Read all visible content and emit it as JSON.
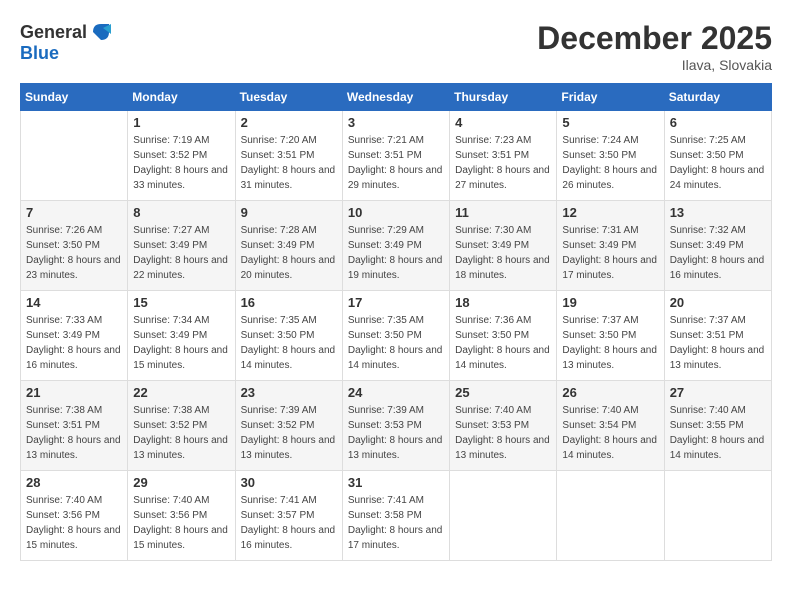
{
  "header": {
    "logo_general": "General",
    "logo_blue": "Blue",
    "month_title": "December 2025",
    "location": "Ilava, Slovakia"
  },
  "days_of_week": [
    "Sunday",
    "Monday",
    "Tuesday",
    "Wednesday",
    "Thursday",
    "Friday",
    "Saturday"
  ],
  "weeks": [
    [
      {
        "day": "",
        "sunrise": "",
        "sunset": "",
        "daylight": ""
      },
      {
        "day": "1",
        "sunrise": "Sunrise: 7:19 AM",
        "sunset": "Sunset: 3:52 PM",
        "daylight": "Daylight: 8 hours and 33 minutes."
      },
      {
        "day": "2",
        "sunrise": "Sunrise: 7:20 AM",
        "sunset": "Sunset: 3:51 PM",
        "daylight": "Daylight: 8 hours and 31 minutes."
      },
      {
        "day": "3",
        "sunrise": "Sunrise: 7:21 AM",
        "sunset": "Sunset: 3:51 PM",
        "daylight": "Daylight: 8 hours and 29 minutes."
      },
      {
        "day": "4",
        "sunrise": "Sunrise: 7:23 AM",
        "sunset": "Sunset: 3:51 PM",
        "daylight": "Daylight: 8 hours and 27 minutes."
      },
      {
        "day": "5",
        "sunrise": "Sunrise: 7:24 AM",
        "sunset": "Sunset: 3:50 PM",
        "daylight": "Daylight: 8 hours and 26 minutes."
      },
      {
        "day": "6",
        "sunrise": "Sunrise: 7:25 AM",
        "sunset": "Sunset: 3:50 PM",
        "daylight": "Daylight: 8 hours and 24 minutes."
      }
    ],
    [
      {
        "day": "7",
        "sunrise": "Sunrise: 7:26 AM",
        "sunset": "Sunset: 3:50 PM",
        "daylight": "Daylight: 8 hours and 23 minutes."
      },
      {
        "day": "8",
        "sunrise": "Sunrise: 7:27 AM",
        "sunset": "Sunset: 3:49 PM",
        "daylight": "Daylight: 8 hours and 22 minutes."
      },
      {
        "day": "9",
        "sunrise": "Sunrise: 7:28 AM",
        "sunset": "Sunset: 3:49 PM",
        "daylight": "Daylight: 8 hours and 20 minutes."
      },
      {
        "day": "10",
        "sunrise": "Sunrise: 7:29 AM",
        "sunset": "Sunset: 3:49 PM",
        "daylight": "Daylight: 8 hours and 19 minutes."
      },
      {
        "day": "11",
        "sunrise": "Sunrise: 7:30 AM",
        "sunset": "Sunset: 3:49 PM",
        "daylight": "Daylight: 8 hours and 18 minutes."
      },
      {
        "day": "12",
        "sunrise": "Sunrise: 7:31 AM",
        "sunset": "Sunset: 3:49 PM",
        "daylight": "Daylight: 8 hours and 17 minutes."
      },
      {
        "day": "13",
        "sunrise": "Sunrise: 7:32 AM",
        "sunset": "Sunset: 3:49 PM",
        "daylight": "Daylight: 8 hours and 16 minutes."
      }
    ],
    [
      {
        "day": "14",
        "sunrise": "Sunrise: 7:33 AM",
        "sunset": "Sunset: 3:49 PM",
        "daylight": "Daylight: 8 hours and 16 minutes."
      },
      {
        "day": "15",
        "sunrise": "Sunrise: 7:34 AM",
        "sunset": "Sunset: 3:49 PM",
        "daylight": "Daylight: 8 hours and 15 minutes."
      },
      {
        "day": "16",
        "sunrise": "Sunrise: 7:35 AM",
        "sunset": "Sunset: 3:50 PM",
        "daylight": "Daylight: 8 hours and 14 minutes."
      },
      {
        "day": "17",
        "sunrise": "Sunrise: 7:35 AM",
        "sunset": "Sunset: 3:50 PM",
        "daylight": "Daylight: 8 hours and 14 minutes."
      },
      {
        "day": "18",
        "sunrise": "Sunrise: 7:36 AM",
        "sunset": "Sunset: 3:50 PM",
        "daylight": "Daylight: 8 hours and 14 minutes."
      },
      {
        "day": "19",
        "sunrise": "Sunrise: 7:37 AM",
        "sunset": "Sunset: 3:50 PM",
        "daylight": "Daylight: 8 hours and 13 minutes."
      },
      {
        "day": "20",
        "sunrise": "Sunrise: 7:37 AM",
        "sunset": "Sunset: 3:51 PM",
        "daylight": "Daylight: 8 hours and 13 minutes."
      }
    ],
    [
      {
        "day": "21",
        "sunrise": "Sunrise: 7:38 AM",
        "sunset": "Sunset: 3:51 PM",
        "daylight": "Daylight: 8 hours and 13 minutes."
      },
      {
        "day": "22",
        "sunrise": "Sunrise: 7:38 AM",
        "sunset": "Sunset: 3:52 PM",
        "daylight": "Daylight: 8 hours and 13 minutes."
      },
      {
        "day": "23",
        "sunrise": "Sunrise: 7:39 AM",
        "sunset": "Sunset: 3:52 PM",
        "daylight": "Daylight: 8 hours and 13 minutes."
      },
      {
        "day": "24",
        "sunrise": "Sunrise: 7:39 AM",
        "sunset": "Sunset: 3:53 PM",
        "daylight": "Daylight: 8 hours and 13 minutes."
      },
      {
        "day": "25",
        "sunrise": "Sunrise: 7:40 AM",
        "sunset": "Sunset: 3:53 PM",
        "daylight": "Daylight: 8 hours and 13 minutes."
      },
      {
        "day": "26",
        "sunrise": "Sunrise: 7:40 AM",
        "sunset": "Sunset: 3:54 PM",
        "daylight": "Daylight: 8 hours and 14 minutes."
      },
      {
        "day": "27",
        "sunrise": "Sunrise: 7:40 AM",
        "sunset": "Sunset: 3:55 PM",
        "daylight": "Daylight: 8 hours and 14 minutes."
      }
    ],
    [
      {
        "day": "28",
        "sunrise": "Sunrise: 7:40 AM",
        "sunset": "Sunset: 3:56 PM",
        "daylight": "Daylight: 8 hours and 15 minutes."
      },
      {
        "day": "29",
        "sunrise": "Sunrise: 7:40 AM",
        "sunset": "Sunset: 3:56 PM",
        "daylight": "Daylight: 8 hours and 15 minutes."
      },
      {
        "day": "30",
        "sunrise": "Sunrise: 7:41 AM",
        "sunset": "Sunset: 3:57 PM",
        "daylight": "Daylight: 8 hours and 16 minutes."
      },
      {
        "day": "31",
        "sunrise": "Sunrise: 7:41 AM",
        "sunset": "Sunset: 3:58 PM",
        "daylight": "Daylight: 8 hours and 17 minutes."
      },
      {
        "day": "",
        "sunrise": "",
        "sunset": "",
        "daylight": ""
      },
      {
        "day": "",
        "sunrise": "",
        "sunset": "",
        "daylight": ""
      },
      {
        "day": "",
        "sunrise": "",
        "sunset": "",
        "daylight": ""
      }
    ]
  ]
}
